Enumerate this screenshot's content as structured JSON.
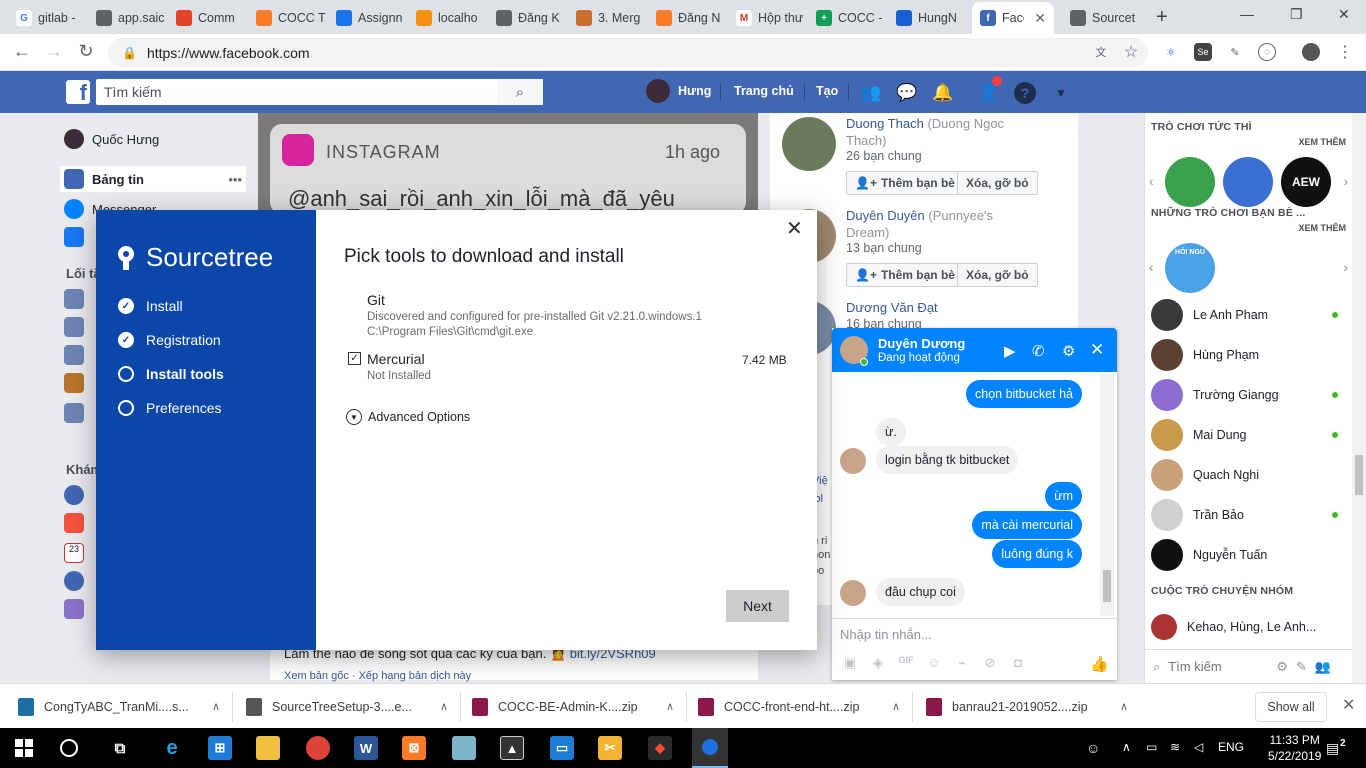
{
  "browser": {
    "tabs": [
      {
        "title": "gitlab -",
        "icon": "google-icon",
        "color": "#ffffff"
      },
      {
        "title": "app.saic",
        "icon": "globe-icon",
        "color": "#5f6368"
      },
      {
        "title": "Comm",
        "icon": "gitlab-icon",
        "color": "#e24329"
      },
      {
        "title": "COCC T",
        "icon": "xampp-icon",
        "color": "#fb7a24"
      },
      {
        "title": "Assignn",
        "icon": "loading-icon",
        "color": "#1a73e8"
      },
      {
        "title": "localho",
        "icon": "phpmyadmin-icon",
        "color": "#f29111"
      },
      {
        "title": "Đăng K",
        "icon": "globe-icon",
        "color": "#5f6368"
      },
      {
        "title": "3. Merg",
        "icon": "udemy-icon",
        "color": "#c8702e"
      },
      {
        "title": "Đăng N",
        "icon": "xampp-icon",
        "color": "#fb7a24"
      },
      {
        "title": "Hộp thư",
        "icon": "gmail-icon",
        "color": "#d93025"
      },
      {
        "title": "COCC -",
        "icon": "sheets-icon",
        "color": "#0f9d58"
      },
      {
        "title": "HungN",
        "icon": "shield-icon",
        "color": "#1a5fd1"
      },
      {
        "title": "Face",
        "icon": "facebook-icon",
        "color": "#4267b2"
      },
      {
        "title": "Sourcet",
        "icon": "globe-icon",
        "color": "#5f6368"
      }
    ],
    "url": "https://www.facebook.com"
  },
  "facebook": {
    "search_placeholder": "Tìm kiếm",
    "nav": {
      "user": "Hưng",
      "home": "Trang chủ",
      "create": "Tạo"
    },
    "left": {
      "profile": "Quốc Hưng",
      "newsfeed": "Bảng tin",
      "messenger": "Messenger",
      "shortcuts_head": "Lối tắ",
      "explore_head": "Khám"
    },
    "instagram": {
      "brand": "INSTAGRAM",
      "time": "1h ago",
      "text": "@anh_sai_rồi_anh_xin_lỗi_mà_đã_yêu"
    },
    "feed_bottom": {
      "text": "Làm thế nào để sống sót qua các kỳ của bạn. 🙍",
      "link": "bit.ly/2VSRh09",
      "footer": "Xem bản gốc · Xếp hạng bản dịch này"
    },
    "pymk": [
      {
        "name": "Duong Thach",
        "alt": "(Duong Ngoc Thach)",
        "mutual": "26 bạn chung"
      },
      {
        "name": "Duyên Duyên",
        "alt": "(Punnyee's Dream)",
        "mutual": "13 bạn chung"
      },
      {
        "name": "Dương Văn Đạt",
        "alt": "",
        "mutual": "16 bạn chung"
      }
    ],
    "add_friend": "Thêm bạn bè",
    "remove": "Xóa, gỡ bỏ",
    "mid_snip": [
      "Việ",
      "iol",
      "n ri",
      "hon",
      "oo"
    ],
    "right": {
      "instant_games": "TRÒ CHƠI TỨC THÌ",
      "see_more": "XEM THÊM",
      "friends_games": "NHỮNG TRÒ CHƠI BẠN BÈ ...",
      "see_more2": "XEM THÊM",
      "game_badge": "HỎI NGU",
      "contacts": [
        {
          "name": "Le Anh Pham",
          "online": true
        },
        {
          "name": "Hùng Phạm",
          "online": false
        },
        {
          "name": "Trường Giangg",
          "online": true
        },
        {
          "name": "Mai Dung",
          "online": true
        },
        {
          "name": "Quach Nghi",
          "online": false
        },
        {
          "name": "Trần Bảo",
          "online": true
        },
        {
          "name": "Nguyễn Tuấn",
          "online": false
        }
      ],
      "group_head": "CUỘC TRÒ CHUYỆN NHÓM",
      "group": "Kehao, Hùng, Le Anh...",
      "search_placeholder": "Tìm kiếm"
    },
    "chat": {
      "name": "Duyên Dương",
      "status": "Đang hoạt động",
      "messages": [
        {
          "from": "me",
          "text": "chọn bitbucket hả"
        },
        {
          "from": "them",
          "text": "ừ."
        },
        {
          "from": "them",
          "text": "login bằng tk bitbucket"
        },
        {
          "from": "me",
          "text": "ừm"
        },
        {
          "from": "me",
          "text": "mà cài mercurial"
        },
        {
          "from": "me",
          "text": "luông đúng k"
        },
        {
          "from": "them",
          "text": "đâu chụp coi"
        }
      ],
      "input_placeholder": "Nhập tin nhắn..."
    }
  },
  "sourcetree": {
    "brand": "Sourcetree",
    "steps": [
      {
        "label": "Install",
        "state": "done"
      },
      {
        "label": "Registration",
        "state": "done"
      },
      {
        "label": "Install tools",
        "state": "current"
      },
      {
        "label": "Preferences",
        "state": "todo"
      }
    ],
    "title": "Pick tools to download and install",
    "git": {
      "name": "Git",
      "desc1": "Discovered and configured for pre-installed Git v2.21.0.windows.1",
      "desc2": "C:\\Program Files\\Git\\cmd\\git.exe"
    },
    "mercurial": {
      "name": "Mercurial",
      "status": "Not Installed",
      "size": "7.42 MB",
      "checked": true
    },
    "advanced": "Advanced Options",
    "next": "Next"
  },
  "downloads": {
    "items": [
      {
        "name": "CongTyABC_TranMi....s...",
        "color": "#1d6fa5"
      },
      {
        "name": "SourceTreeSetup-3....e...",
        "color": "#555555"
      },
      {
        "name": "COCC-BE-Admin-K....zip",
        "color": "#8b1a4b"
      },
      {
        "name": "COCC-front-end-ht....zip",
        "color": "#8b1a4b"
      },
      {
        "name": "banrau21-2019052....zip",
        "color": "#8b1a4b"
      }
    ],
    "show_all": "Show all"
  },
  "taskbar": {
    "lang": "ENG",
    "time": "11:33 PM",
    "date": "5/22/2019",
    "notif": "2"
  }
}
